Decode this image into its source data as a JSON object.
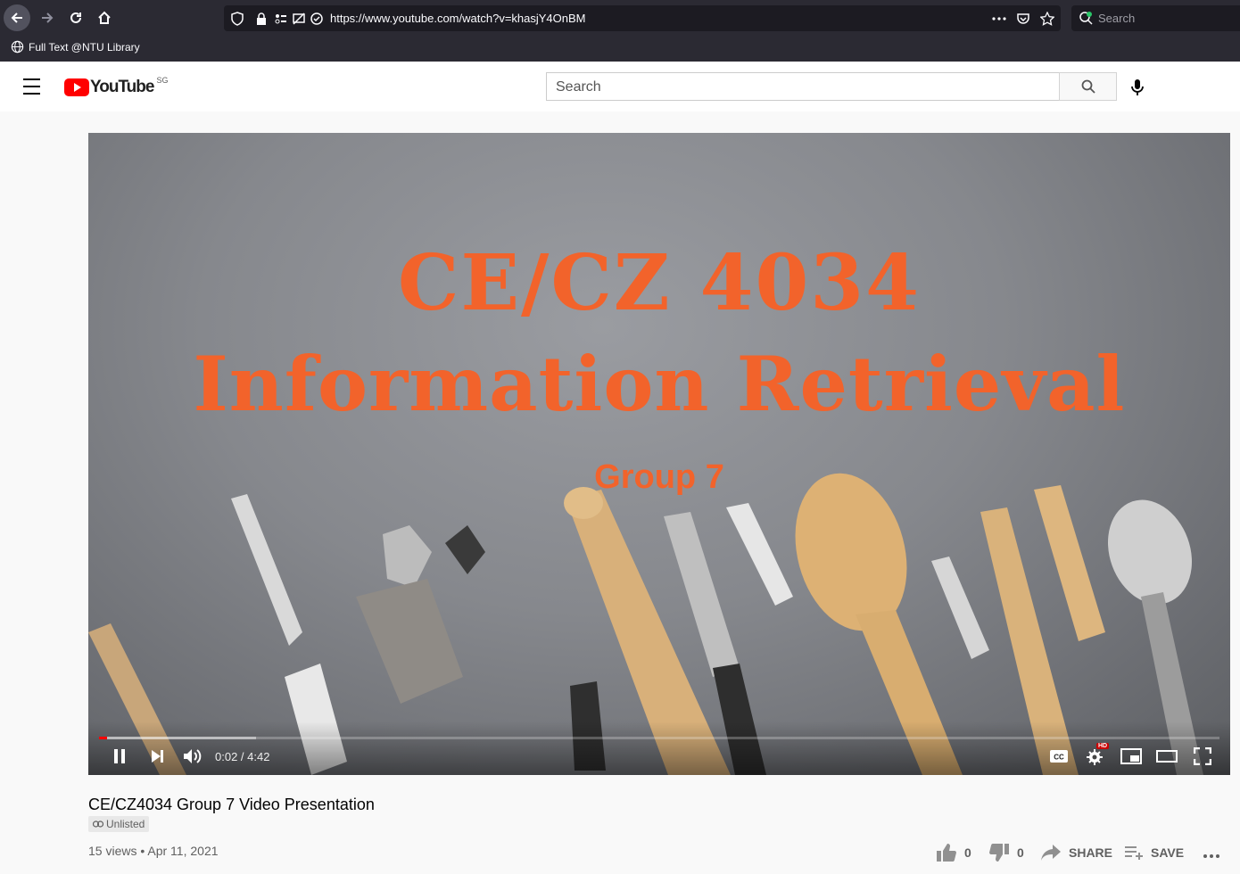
{
  "browser": {
    "url": "https://www.youtube.com/watch?v=khasjY4OnBM",
    "search_placeholder": "Search",
    "bookmark_label": "Full Text @NTU Library"
  },
  "header": {
    "logo_text": "YouTube",
    "region": "SG",
    "search_placeholder": "Search"
  },
  "video": {
    "title_line1": "CE/CZ 4034",
    "title_line2": "Information Retrieval",
    "title_line3": "Group 7",
    "time_display": "0:02 / 4:42",
    "progress_fraction": 0.007,
    "buffer_fraction": 0.14,
    "quality_badge": "HD"
  },
  "info": {
    "title": "CE/CZ4034 Group 7 Video Presentation",
    "privacy": "Unlisted",
    "meta": "15 views • Apr 11, 2021",
    "likes": "0",
    "dislikes": "0",
    "share_label": "SHARE",
    "save_label": "SAVE"
  },
  "colors": {
    "title_orange": "#f2632b",
    "youtube_red": "#ff0000"
  }
}
